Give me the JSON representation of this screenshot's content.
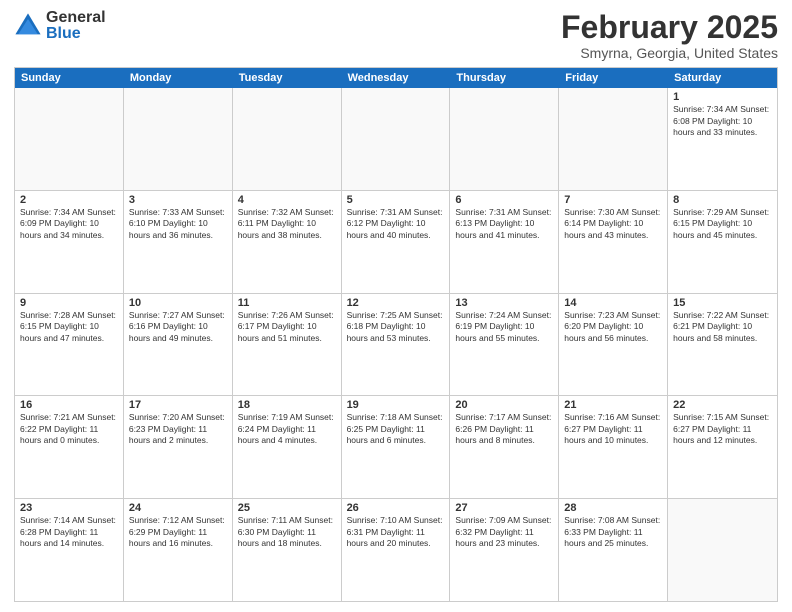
{
  "logo": {
    "general": "General",
    "blue": "Blue"
  },
  "title": "February 2025",
  "location": "Smyrna, Georgia, United States",
  "weekdays": [
    "Sunday",
    "Monday",
    "Tuesday",
    "Wednesday",
    "Thursday",
    "Friday",
    "Saturday"
  ],
  "weeks": [
    [
      {
        "day": "",
        "info": ""
      },
      {
        "day": "",
        "info": ""
      },
      {
        "day": "",
        "info": ""
      },
      {
        "day": "",
        "info": ""
      },
      {
        "day": "",
        "info": ""
      },
      {
        "day": "",
        "info": ""
      },
      {
        "day": "1",
        "info": "Sunrise: 7:34 AM\nSunset: 6:08 PM\nDaylight: 10 hours and 33 minutes."
      }
    ],
    [
      {
        "day": "2",
        "info": "Sunrise: 7:34 AM\nSunset: 6:09 PM\nDaylight: 10 hours and 34 minutes."
      },
      {
        "day": "3",
        "info": "Sunrise: 7:33 AM\nSunset: 6:10 PM\nDaylight: 10 hours and 36 minutes."
      },
      {
        "day": "4",
        "info": "Sunrise: 7:32 AM\nSunset: 6:11 PM\nDaylight: 10 hours and 38 minutes."
      },
      {
        "day": "5",
        "info": "Sunrise: 7:31 AM\nSunset: 6:12 PM\nDaylight: 10 hours and 40 minutes."
      },
      {
        "day": "6",
        "info": "Sunrise: 7:31 AM\nSunset: 6:13 PM\nDaylight: 10 hours and 41 minutes."
      },
      {
        "day": "7",
        "info": "Sunrise: 7:30 AM\nSunset: 6:14 PM\nDaylight: 10 hours and 43 minutes."
      },
      {
        "day": "8",
        "info": "Sunrise: 7:29 AM\nSunset: 6:15 PM\nDaylight: 10 hours and 45 minutes."
      }
    ],
    [
      {
        "day": "9",
        "info": "Sunrise: 7:28 AM\nSunset: 6:15 PM\nDaylight: 10 hours and 47 minutes."
      },
      {
        "day": "10",
        "info": "Sunrise: 7:27 AM\nSunset: 6:16 PM\nDaylight: 10 hours and 49 minutes."
      },
      {
        "day": "11",
        "info": "Sunrise: 7:26 AM\nSunset: 6:17 PM\nDaylight: 10 hours and 51 minutes."
      },
      {
        "day": "12",
        "info": "Sunrise: 7:25 AM\nSunset: 6:18 PM\nDaylight: 10 hours and 53 minutes."
      },
      {
        "day": "13",
        "info": "Sunrise: 7:24 AM\nSunset: 6:19 PM\nDaylight: 10 hours and 55 minutes."
      },
      {
        "day": "14",
        "info": "Sunrise: 7:23 AM\nSunset: 6:20 PM\nDaylight: 10 hours and 56 minutes."
      },
      {
        "day": "15",
        "info": "Sunrise: 7:22 AM\nSunset: 6:21 PM\nDaylight: 10 hours and 58 minutes."
      }
    ],
    [
      {
        "day": "16",
        "info": "Sunrise: 7:21 AM\nSunset: 6:22 PM\nDaylight: 11 hours and 0 minutes."
      },
      {
        "day": "17",
        "info": "Sunrise: 7:20 AM\nSunset: 6:23 PM\nDaylight: 11 hours and 2 minutes."
      },
      {
        "day": "18",
        "info": "Sunrise: 7:19 AM\nSunset: 6:24 PM\nDaylight: 11 hours and 4 minutes."
      },
      {
        "day": "19",
        "info": "Sunrise: 7:18 AM\nSunset: 6:25 PM\nDaylight: 11 hours and 6 minutes."
      },
      {
        "day": "20",
        "info": "Sunrise: 7:17 AM\nSunset: 6:26 PM\nDaylight: 11 hours and 8 minutes."
      },
      {
        "day": "21",
        "info": "Sunrise: 7:16 AM\nSunset: 6:27 PM\nDaylight: 11 hours and 10 minutes."
      },
      {
        "day": "22",
        "info": "Sunrise: 7:15 AM\nSunset: 6:27 PM\nDaylight: 11 hours and 12 minutes."
      }
    ],
    [
      {
        "day": "23",
        "info": "Sunrise: 7:14 AM\nSunset: 6:28 PM\nDaylight: 11 hours and 14 minutes."
      },
      {
        "day": "24",
        "info": "Sunrise: 7:12 AM\nSunset: 6:29 PM\nDaylight: 11 hours and 16 minutes."
      },
      {
        "day": "25",
        "info": "Sunrise: 7:11 AM\nSunset: 6:30 PM\nDaylight: 11 hours and 18 minutes."
      },
      {
        "day": "26",
        "info": "Sunrise: 7:10 AM\nSunset: 6:31 PM\nDaylight: 11 hours and 20 minutes."
      },
      {
        "day": "27",
        "info": "Sunrise: 7:09 AM\nSunset: 6:32 PM\nDaylight: 11 hours and 23 minutes."
      },
      {
        "day": "28",
        "info": "Sunrise: 7:08 AM\nSunset: 6:33 PM\nDaylight: 11 hours and 25 minutes."
      },
      {
        "day": "",
        "info": ""
      }
    ]
  ]
}
